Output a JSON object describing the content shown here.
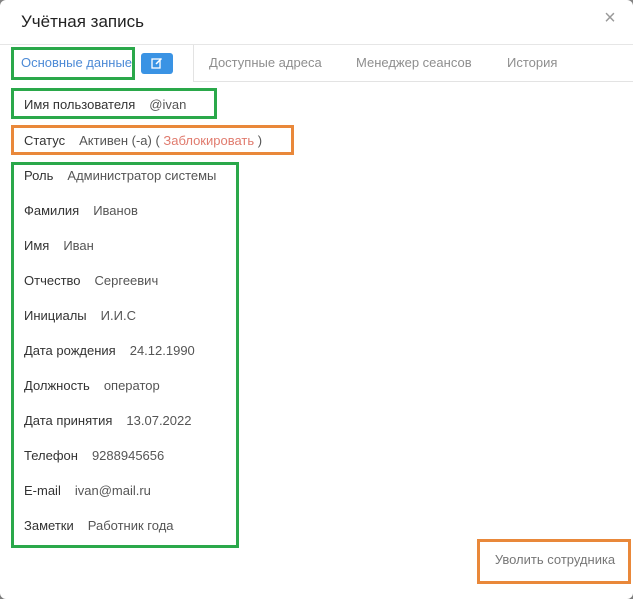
{
  "window": {
    "title": "Учётная запись"
  },
  "tabs": [
    {
      "label": "Основные данные"
    },
    {
      "label": "Доступные адреса"
    },
    {
      "label": "Менеджер сеансов"
    },
    {
      "label": "История"
    }
  ],
  "icons": {
    "close": "close-icon",
    "edit": "edit-icon"
  },
  "username": {
    "label": "Имя пользователя",
    "value": "@ivan"
  },
  "status": {
    "label": "Статус",
    "value": "Активен (-а) (",
    "action": "Заблокировать",
    "close_paren": ")"
  },
  "fields": [
    {
      "label": "Роль",
      "value": "Администратор системы"
    },
    {
      "label": "Фамилия",
      "value": "Иванов"
    },
    {
      "label": "Имя",
      "value": "Иван"
    },
    {
      "label": "Отчество",
      "value": "Сергеевич"
    },
    {
      "label": "Инициалы",
      "value": "И.И.С"
    },
    {
      "label": "Дата рождения",
      "value": "24.12.1990"
    },
    {
      "label": "Должность",
      "value": "оператор"
    },
    {
      "label": "Дата принятия",
      "value": "13.07.2022"
    },
    {
      "label": "Телефон",
      "value": "9288945656"
    },
    {
      "label": "E-mail",
      "value": "ivan@mail.ru"
    },
    {
      "label": "Заметки",
      "value": "Работник года"
    }
  ],
  "footer": {
    "fire_label": "Уволить сотрудника"
  },
  "colors": {
    "accent": "#3a93e4",
    "highlight_green": "#2aa84a",
    "highlight_orange": "#e9883a",
    "danger_link": "#e07b6e"
  }
}
